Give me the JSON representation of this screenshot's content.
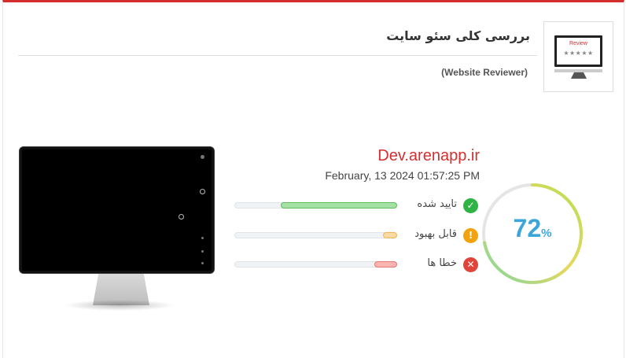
{
  "header": {
    "title": "بررسی کلی سئو سایت",
    "subtitle": "(Website Reviewer)",
    "thumbnail": {
      "label": "Review",
      "stars": "★★★★★"
    }
  },
  "site": {
    "url": "Dev.arenapp.ir",
    "date": "February, 13 2024 01:57:25 PM"
  },
  "metrics": [
    {
      "label": "تایید شده",
      "icon": "check-icon",
      "glyph": "✓",
      "color": "#2fb344",
      "fill_color": "#a5e1a5",
      "fill_border": "#5cbf5c",
      "level": 0.72
    },
    {
      "label": "قابل بهبود",
      "icon": "warning-icon",
      "glyph": "!",
      "color": "#f2a20c",
      "fill_color": "#fbd9a3",
      "fill_border": "#f2b35a",
      "level": 0.09
    },
    {
      "label": "خطا ها",
      "icon": "error-icon",
      "glyph": "✕",
      "color": "#e0453a",
      "fill_color": "#f7b4b0",
      "fill_border": "#e77a73",
      "level": 0.14
    }
  ],
  "score": {
    "value": "72",
    "unit": "%",
    "percent": 72,
    "gradient": [
      "#7bd8a0",
      "#e8d85c",
      "#b9dd55"
    ],
    "track_color": "#e5e5e5"
  }
}
